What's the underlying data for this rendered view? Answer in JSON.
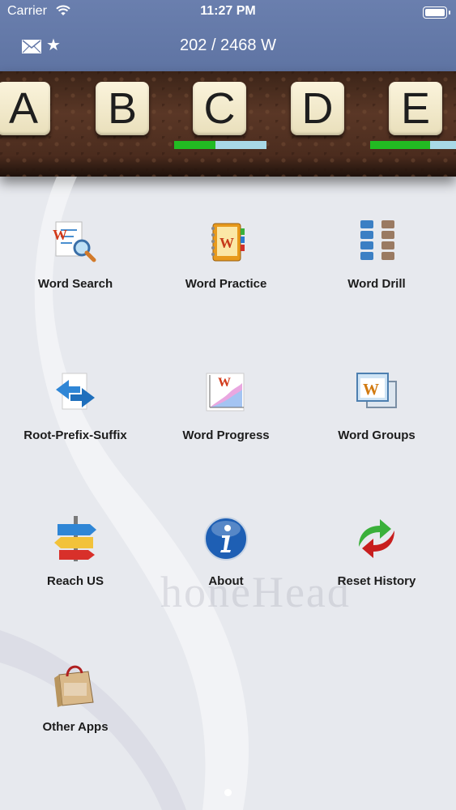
{
  "status_bar": {
    "carrier": "Carrier",
    "time": "11:27 PM"
  },
  "header": {
    "word_count": "202 / 2468 W",
    "mail_icon": "mail-icon",
    "star_icon": "star-icon"
  },
  "letters": [
    {
      "letter": "A",
      "progress": null
    },
    {
      "letter": "B",
      "progress": null
    },
    {
      "letter": "C",
      "progress": 0.45
    },
    {
      "letter": "D",
      "progress": null
    },
    {
      "letter": "E",
      "progress": 0.65
    }
  ],
  "menu": [
    {
      "label": "Word Search",
      "icon": "word-search-icon"
    },
    {
      "label": "Word Practice",
      "icon": "word-practice-icon"
    },
    {
      "label": "Word Drill",
      "icon": "word-drill-icon"
    },
    {
      "label": "Root-Prefix-Suffix",
      "icon": "root-prefix-suffix-icon"
    },
    {
      "label": "Word Progress",
      "icon": "word-progress-icon"
    },
    {
      "label": "Word Groups",
      "icon": "word-groups-icon"
    },
    {
      "label": "Reach US",
      "icon": "signpost-icon"
    },
    {
      "label": "About",
      "icon": "info-icon"
    },
    {
      "label": "Reset History",
      "icon": "reset-arrows-icon"
    },
    {
      "label": "Other Apps",
      "icon": "shopping-bag-icon"
    }
  ],
  "watermark": "honeHead",
  "colors": {
    "header": "#6478a8",
    "progress_done": "#22bb22",
    "progress_left": "#a8d8e6"
  }
}
